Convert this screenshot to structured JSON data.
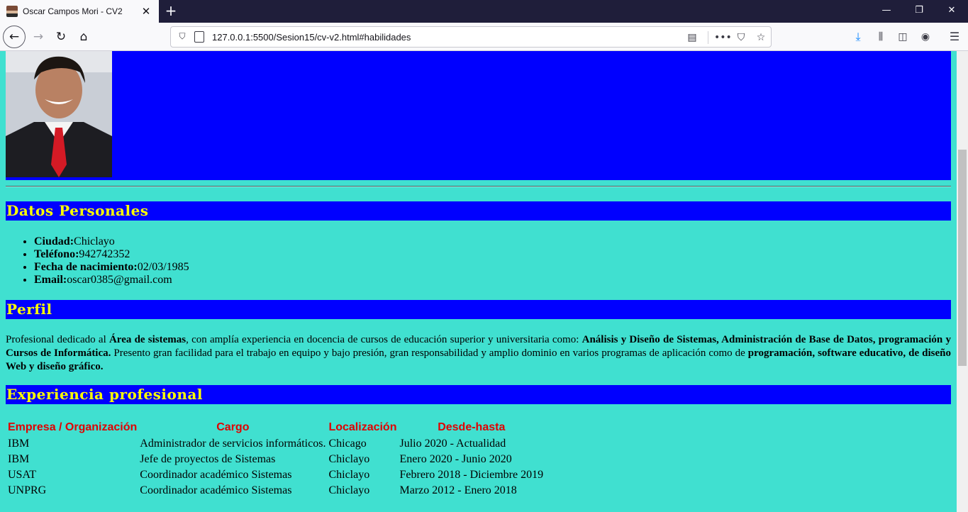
{
  "browser": {
    "tab_title": "Oscar Campos Mori - CV2",
    "tab_close": "✕",
    "new_tab": "+",
    "url": "127.0.0.1:5500/Sesion15/cv-v2.html#habilidades",
    "window_controls": {
      "minimize": "—",
      "maximize": "❐",
      "close": "✕"
    },
    "nav": {
      "back": "←",
      "forward": "→",
      "reload": "↻",
      "home": "⌂"
    },
    "icons": {
      "shield": "⛉",
      "reader": "▤",
      "more": "•••",
      "pocket": "⛉",
      "star": "☆",
      "download": "⤓",
      "library": "⫼",
      "sidebar": "◫",
      "account": "◉",
      "menu": "☰"
    }
  },
  "cv": {
    "sections": {
      "datos": "Datos Personales",
      "perfil": "Perfil",
      "experiencia": "Experiencia profesional"
    },
    "datos_personales": [
      {
        "label": "Ciudad:",
        "value": "Chiclayo"
      },
      {
        "label": "Teléfono:",
        "value": "942742352"
      },
      {
        "label": "Fecha de nacimiento:",
        "value": "02/03/1985"
      },
      {
        "label": "Email:",
        "value": "oscar0385@gmail.com"
      }
    ],
    "perfil": {
      "p1": "Profesional dedicado al ",
      "b1": "Área de sistemas",
      "p2": ", con amplía experiencia en docencia de cursos de educación superior y universitaria como: ",
      "b2": "Análisis y Diseño de Sistemas, Administración de Base de Datos, programación y Cursos de Informática.",
      "p3": " Presento gran facilidad para el trabajo en equipo y bajo presión, gran responsabilidad y amplio dominio en varios programas de aplicación como de ",
      "b3": "programación, software educativo, de diseño Web y diseño gráfico."
    },
    "experiencia": {
      "headers": [
        "Empresa / Organización",
        "Cargo",
        "Localización",
        "Desde-hasta"
      ],
      "rows": [
        [
          "IBM",
          "Administrador de servicios informáticos.",
          "Chicago",
          "Julio 2020 - Actualidad"
        ],
        [
          "IBM",
          "Jefe de proyectos de Sistemas",
          "Chiclayo",
          "Enero 2020 - Junio 2020"
        ],
        [
          "USAT",
          "Coordinador académico Sistemas",
          "Chiclayo",
          "Febrero 2018 - Diciembre 2019"
        ],
        [
          "UNPRG",
          "Coordinador académico Sistemas",
          "Chiclayo",
          "Marzo 2012 - Enero 2018"
        ]
      ]
    },
    "colors": {
      "page_bg": "#40E0D0",
      "band_bg": "#0000FF",
      "heading_text": "#FFFF00",
      "table_header": "#E00000"
    }
  }
}
